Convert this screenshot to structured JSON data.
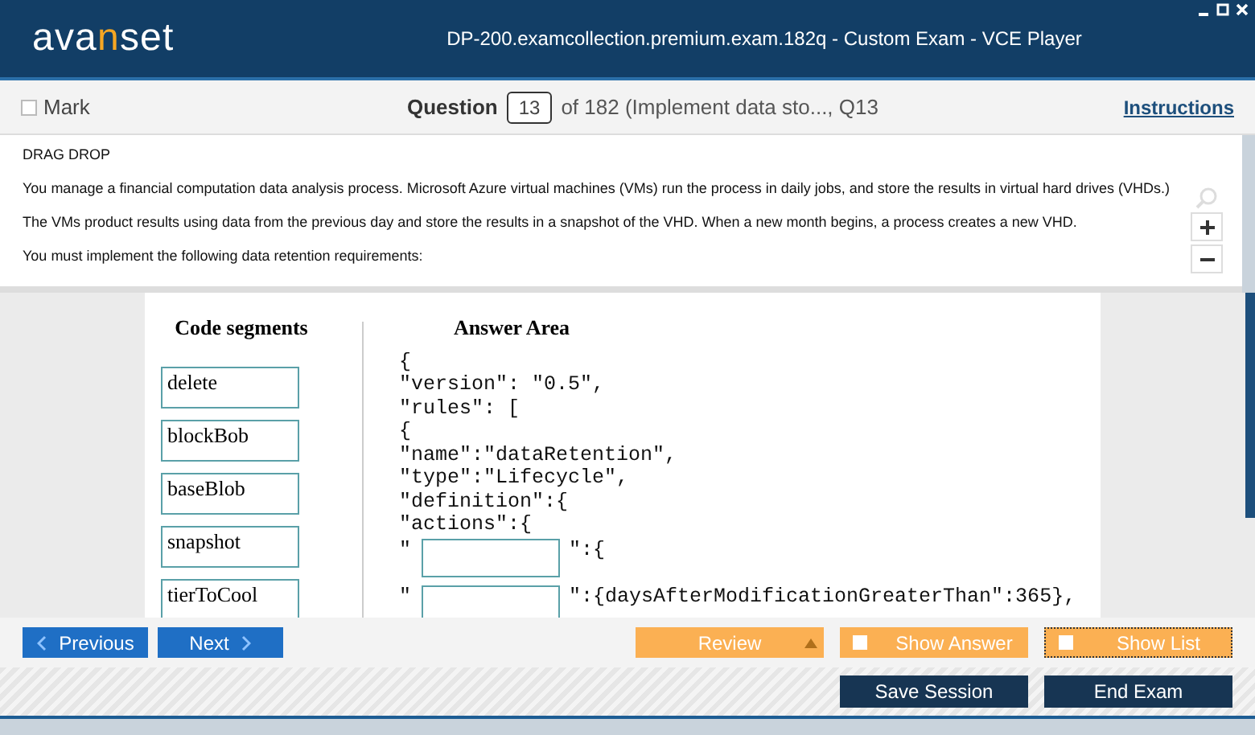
{
  "window": {
    "title": "DP-200.examcollection.premium.exam.182q - Custom Exam - VCE Player",
    "logo": {
      "before": "ava",
      "accent": "n",
      "after": "set"
    }
  },
  "toolbar": {
    "mark": {
      "label": "Mark",
      "checked": false
    },
    "question_label": "Question",
    "question_number": "13",
    "question_suffix": "of 182 (Implement data sto..., Q13",
    "instructions": "Instructions"
  },
  "question": {
    "paragraphs": [
      "DRAG DROP",
      "You manage a financial computation data analysis process. Microsoft Azure virtual machines (VMs) run the process in daily jobs, and store the results in virtual hard drives (VHDs.)",
      "The VMs product results using data from the previous day and store the results in a snapshot of the VHD. When a new month begins, a process creates a new VHD.",
      "You must implement the following data retention requirements:"
    ]
  },
  "exhibit": {
    "segments_title": "Code segments",
    "segments": [
      "delete",
      "blockBob",
      "baseBlob",
      "snapshot",
      "tierToCool"
    ],
    "answer_title": "Answer Area",
    "lines": [
      {
        "kind": "code",
        "text": "{"
      },
      {
        "kind": "code",
        "text": "\"version\": \"0.5\","
      },
      {
        "kind": "code",
        "text": "\"rules\": ["
      },
      {
        "kind": "code",
        "text": "{"
      },
      {
        "kind": "code",
        "text": "\"name\":\"dataRetention\","
      },
      {
        "kind": "code",
        "text": "\"type\":\"Lifecycle\","
      },
      {
        "kind": "code",
        "text": "\"definition\":{"
      },
      {
        "kind": "code",
        "text": "\"actions\":{"
      },
      {
        "kind": "slot",
        "before": "\"",
        "after": "\":{"
      },
      {
        "kind": "slot",
        "before": "\"",
        "after": "\":{daysAfterModificationGreaterThan\":365},"
      }
    ]
  },
  "nav": {
    "previous": "Previous",
    "next": "Next",
    "review": "Review",
    "show_answer": {
      "label": "Show Answer",
      "checked": false
    },
    "show_list": {
      "label": "Show List",
      "checked": false
    }
  },
  "footer": {
    "save": "Save Session",
    "end": "End Exam"
  }
}
